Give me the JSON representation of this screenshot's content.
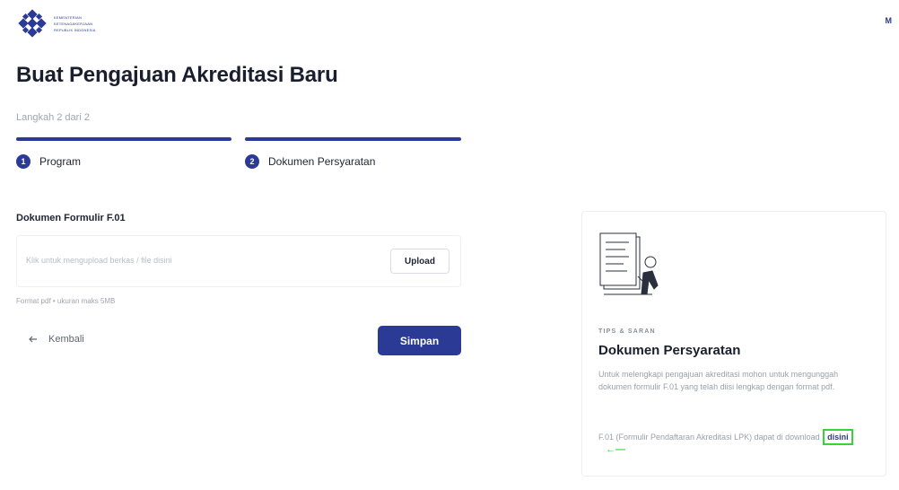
{
  "header": {
    "logo_lines": [
      "KEMENTERIAN",
      "KETENAGAKERJAAN",
      "REPUBLIK INDONESIA"
    ],
    "avatar_initials": "M"
  },
  "page": {
    "title": "Buat Pengajuan Akreditasi Baru",
    "step_count": "Langkah 2 dari 2"
  },
  "steps": [
    {
      "number": "1",
      "label": "Program"
    },
    {
      "number": "2",
      "label": "Dokumen Persyaratan"
    }
  ],
  "form": {
    "field_label": "Dokumen Formulir F.01",
    "upload_placeholder": "Klik untuk mengupload berkas / file disini",
    "upload_button": "Upload",
    "hint": "Format pdf • ukuran maks 5MB",
    "back_label": "Kembali",
    "back_icon": "arrow-left-icon",
    "save_button": "Simpan"
  },
  "tips": {
    "eyebrow": "TIPS & SARAN",
    "title": "Dokumen Persyaratan",
    "description": "Untuk melengkapi pengajuan akreditasi mohon untuk mengunggah dokumen formulir F.01 yang telah diisi lengkap dengan format pdf.",
    "note_text": "F.01 (Formulir Pendaftaran Akreditasi LPK) dapat di download",
    "link_label": "disini",
    "arrow": "←—"
  },
  "colors": {
    "primary": "#2b3a94",
    "highlight": "#3ad13a"
  }
}
